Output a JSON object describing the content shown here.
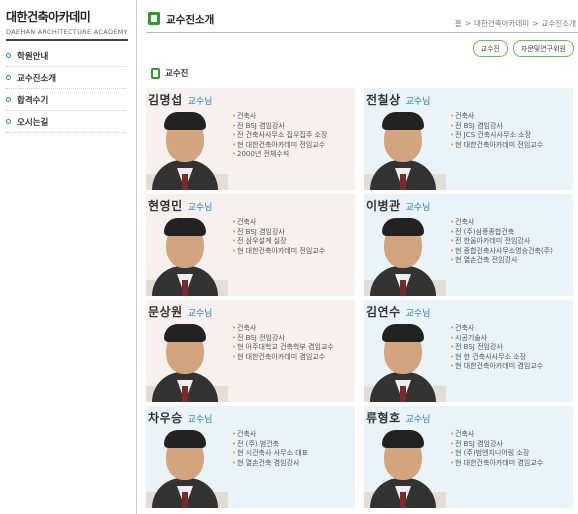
{
  "brand": {
    "title": "대한건축아카데미",
    "subtitle": "DAEHAN ARCHITECTURE ACADEMY"
  },
  "sidebar": {
    "items": [
      {
        "label": "학원안내"
      },
      {
        "label": "교수진소개"
      },
      {
        "label": "합격수기"
      },
      {
        "label": "오시는길"
      }
    ]
  },
  "header": {
    "title": "교수진소개",
    "breadcrumb": [
      "홈",
      "대한건축아카데미",
      "교수진소개"
    ],
    "breadcrumb_sep": ">"
  },
  "buttons": {
    "faculty": "교수진",
    "advisory": "자문및연구위원"
  },
  "section": {
    "title": "교수진"
  },
  "professors": [
    {
      "name": "김명섭",
      "title": "교수님",
      "details": [
        "건축사",
        "전 BSJ 겸임강사",
        "전 건축사사무소 집우집주 소장",
        "현 대한건축아카데미 전임교수",
        "2000년 전체수석"
      ]
    },
    {
      "name": "전칠상",
      "title": "교수님",
      "details": [
        "건축사",
        "전 BSJ 겸임강사",
        "전 JCS 건축사사무소 소장",
        "현 대한건축아카데미 전임교수"
      ]
    },
    {
      "name": "현영민",
      "title": "교수님",
      "details": [
        "건축사",
        "전 BSJ 겸임강사",
        "전 삼우설계 실장",
        "현 대한건축아카데미 전임교수"
      ]
    },
    {
      "name": "이병관",
      "title": "교수님",
      "details": [
        "건축사",
        "전 (주)삼풍종합건축",
        "전 한울아카데미 전임강사",
        "현 종합건축사사무소명승건축(주)",
        "현 열손건축 전임강사"
      ]
    },
    {
      "name": "문상원",
      "title": "교수님",
      "details": [
        "건축사",
        "전 BSJ 전임강사",
        "현 아주대학교 건축학부 겸임교수",
        "현 대한건축아카데미 겸임교수"
      ]
    },
    {
      "name": "김연수",
      "title": "교수님",
      "details": [
        "건축사",
        "시공기술사",
        "전 BSJ 전임강사",
        "현 한 건축사사무소 소장",
        "현 대한건축아카데미 겸임교수"
      ]
    },
    {
      "name": "차우승",
      "title": "교수님",
      "details": [
        "건축사",
        "전 (주) 범건축",
        "현 시건축사 사무소 대표",
        "현 열손건축 겸임강사"
      ]
    },
    {
      "name": "류형호",
      "title": "교수님",
      "details": [
        "건축사",
        "전 BSJ 겸임강사",
        "현 (주)범엔지니어링 소장",
        "현 대한건축아카데미 겸임교수"
      ]
    }
  ],
  "colors": {
    "accent_green": "#2b9b2b",
    "button_border": "#6cbe45",
    "title_blue": "#2a7fb8",
    "bullet_orange": "#f39a22",
    "card_pink": "#f6f0ee",
    "card_blue": "#eaf4f8"
  }
}
